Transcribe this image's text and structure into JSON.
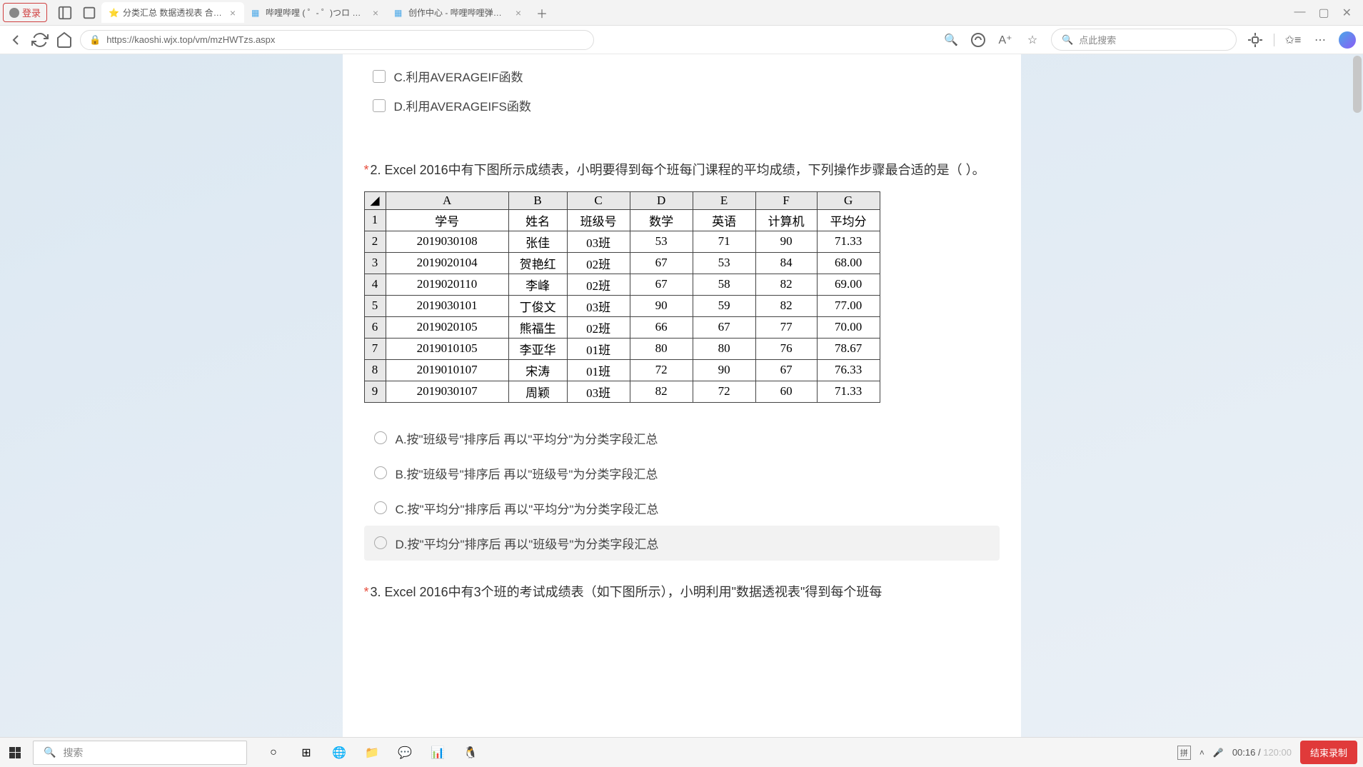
{
  "browser": {
    "login_label": "登录",
    "tabs": [
      {
        "title": "分类汇总 数据透视表 合并计算练",
        "favicon": "star"
      },
      {
        "title": "哔哩哔哩 ( ゜- ゜)つロ 干杯~-bilib",
        "favicon": "bili"
      },
      {
        "title": "创作中心 - 哔哩哔哩弹幕视频网 -",
        "favicon": "bili"
      }
    ],
    "url": "https://kaoshi.wjx.top/vm/mzHWTzs.aspx",
    "search_placeholder": "点此搜索"
  },
  "page": {
    "q1_options_tail": [
      {
        "key": "C",
        "text": "C.利用AVERAGEIF函数"
      },
      {
        "key": "D",
        "text": "D.利用AVERAGEIFS函数"
      }
    ],
    "q2": {
      "number": "2.",
      "title": "Excel 2016中有下图所示成绩表，小明要得到每个班每门课程的平均成绩，下列操作步骤最合适的是（ ）。",
      "options": [
        {
          "key": "A",
          "text": "A.按\"班级号\"排序后 再以\"平均分\"为分类字段汇总"
        },
        {
          "key": "B",
          "text": "B.按\"班级号\"排序后 再以\"班级号\"为分类字段汇总"
        },
        {
          "key": "C",
          "text": "C.按\"平均分\"排序后 再以\"平均分\"为分类字段汇总"
        },
        {
          "key": "D",
          "text": "D.按\"平均分\"排序后 再以\"班级号\"为分类字段汇总"
        }
      ]
    },
    "q3_partial": "3. Excel 2016中有3个班的考试成绩表（如下图所示），小明利用\"数据透视表\"得到每个班每",
    "excel": {
      "cols": [
        "A",
        "B",
        "C",
        "D",
        "E",
        "F",
        "G"
      ],
      "headers": [
        "学号",
        "姓名",
        "班级号",
        "数学",
        "英语",
        "计算机",
        "平均分"
      ],
      "rows": [
        [
          "2019030108",
          "张佳",
          "03班",
          "53",
          "71",
          "90",
          "71.33"
        ],
        [
          "2019020104",
          "贺艳红",
          "02班",
          "67",
          "53",
          "84",
          "68.00"
        ],
        [
          "2019020110",
          "李峰",
          "02班",
          "67",
          "58",
          "82",
          "69.00"
        ],
        [
          "2019030101",
          "丁俊文",
          "03班",
          "90",
          "59",
          "82",
          "77.00"
        ],
        [
          "2019020105",
          "熊福生",
          "02班",
          "66",
          "67",
          "77",
          "70.00"
        ],
        [
          "2019010105",
          "李亚华",
          "01班",
          "80",
          "80",
          "76",
          "78.67"
        ],
        [
          "2019010107",
          "宋涛",
          "01班",
          "72",
          "90",
          "67",
          "76.33"
        ],
        [
          "2019030107",
          "周颖",
          "03班",
          "82",
          "72",
          "60",
          "71.33"
        ]
      ]
    }
  },
  "taskbar": {
    "search_placeholder": "搜索",
    "ime": "拼",
    "timer_elapsed": "00:16",
    "timer_total": "120:00",
    "stop_label": "结束录制"
  }
}
